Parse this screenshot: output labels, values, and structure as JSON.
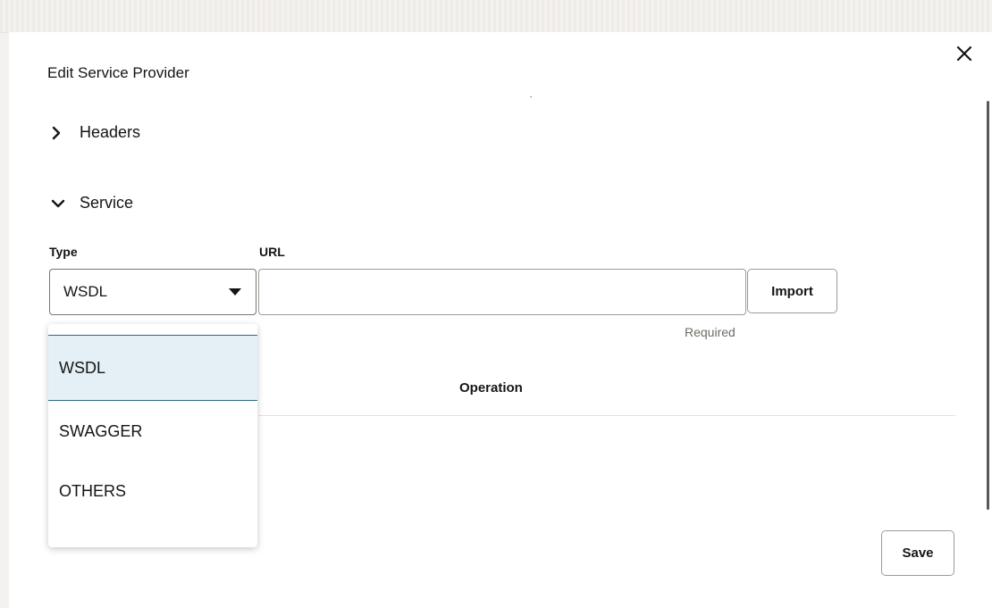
{
  "dialog": {
    "title": "Edit Service Provider",
    "close_icon": "close-icon"
  },
  "sections": {
    "headers": {
      "label": "Headers",
      "expanded": false,
      "icon": "chevron-right-icon"
    },
    "service": {
      "label": "Service",
      "expanded": true,
      "icon": "chevron-down-icon"
    }
  },
  "service": {
    "type_label": "Type",
    "url_label": "URL",
    "type_value": "WSDL",
    "url_value": "",
    "import_label": "Import",
    "required_text": "Required",
    "operation_header": "Operation",
    "type_options": [
      "WSDL",
      "SWAGGER",
      "OTHERS"
    ],
    "selected_option": "WSDL"
  },
  "footer": {
    "save_label": "Save"
  },
  "colors": {
    "selected_bg": "#e4f0f5",
    "selected_border": "#2b6b85",
    "text": "#161513",
    "muted": "#6f6b66"
  }
}
